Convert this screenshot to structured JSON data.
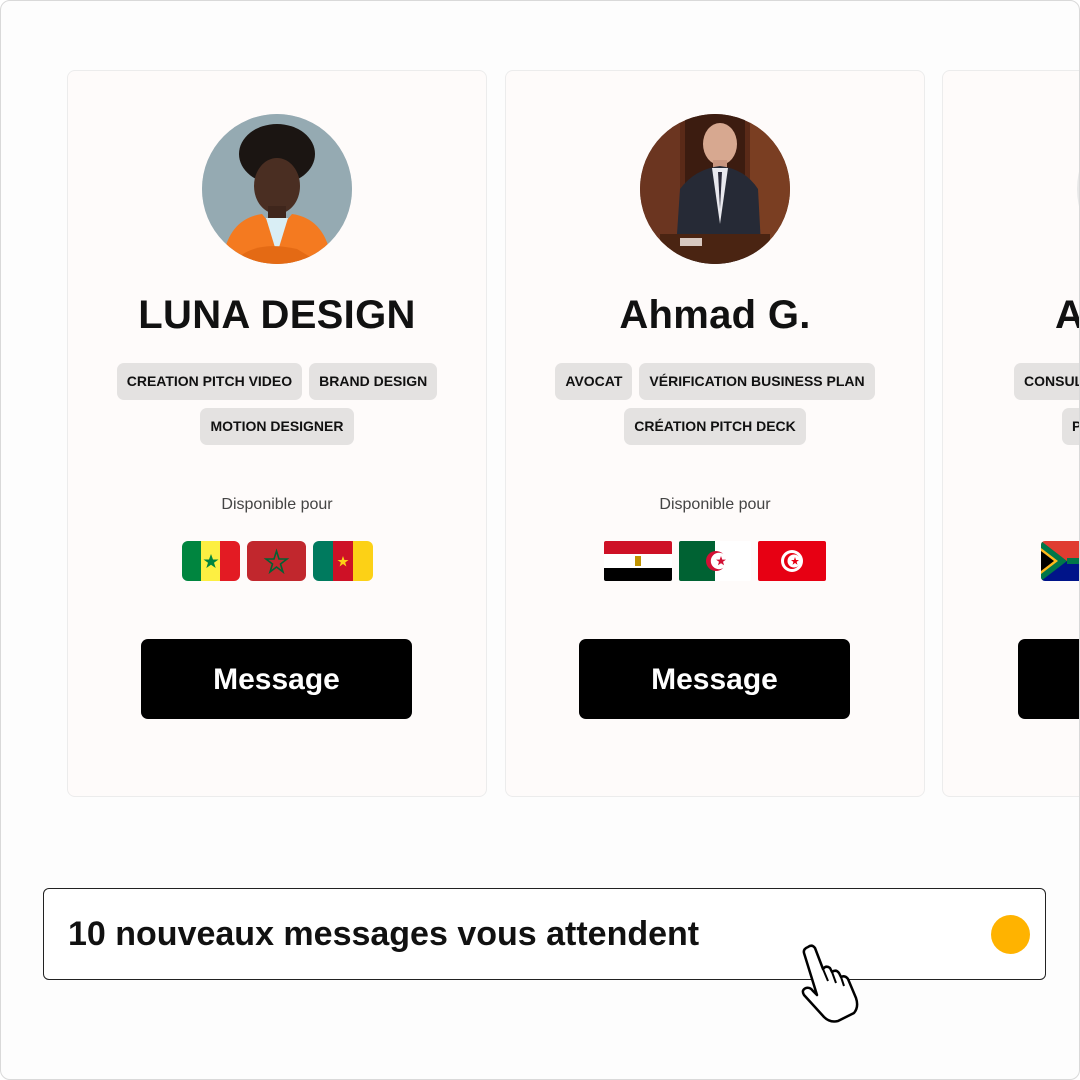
{
  "cards": [
    {
      "name": "LUNA DESIGN",
      "tags": [
        "CREATION PITCH VIDEO",
        "BRAND DESIGN",
        "MOTION DESIGNER"
      ],
      "available_label": "Disponible pour",
      "flags": [
        "senegal-flag-icon",
        "morocco-flag-icon",
        "cameroon-flag-icon"
      ],
      "button_label": "Message"
    },
    {
      "name": "Ahmad G.",
      "tags": [
        "AVOCAT",
        "VÉRIFICATION BUSINESS PLAN",
        "CRÉATION PITCH DECK"
      ],
      "available_label": "Disponible pour",
      "flags": [
        "egypt-flag-icon",
        "algeria-flag-icon",
        "tunisia-flag-icon"
      ],
      "button_label": "Message"
    },
    {
      "name": "A",
      "tags": [
        "CONSUL",
        "P"
      ],
      "available_label": "",
      "flags": [
        "south-africa-flag-icon"
      ],
      "button_label": ""
    }
  ],
  "notification": {
    "text": "10 nouveaux messages vous attendent",
    "dot_color": "#ffb300"
  },
  "colors": {
    "button_bg": "#000000",
    "tag_bg": "#e4e2e1",
    "card_bg": "#fefbfa"
  }
}
